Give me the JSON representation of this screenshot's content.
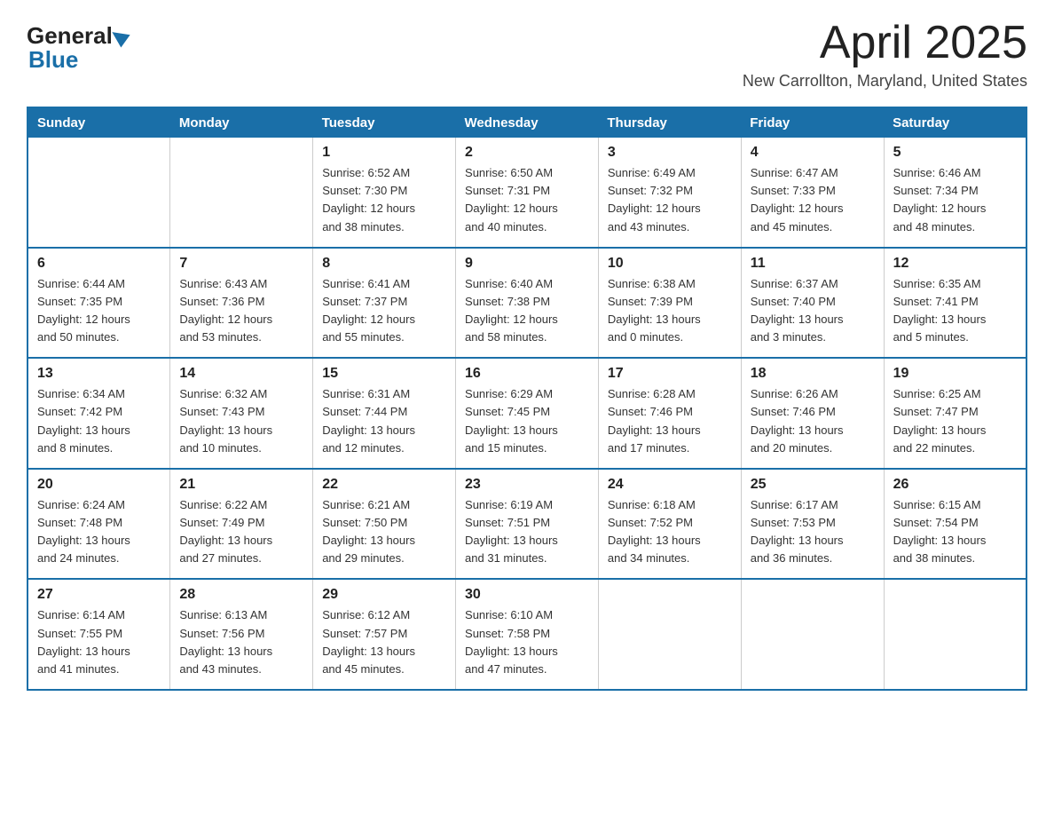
{
  "logo": {
    "general": "General",
    "blue": "Blue"
  },
  "title": "April 2025",
  "location": "New Carrollton, Maryland, United States",
  "weekdays": [
    "Sunday",
    "Monday",
    "Tuesday",
    "Wednesday",
    "Thursday",
    "Friday",
    "Saturday"
  ],
  "weeks": [
    [
      {
        "day": "",
        "info": ""
      },
      {
        "day": "",
        "info": ""
      },
      {
        "day": "1",
        "info": "Sunrise: 6:52 AM\nSunset: 7:30 PM\nDaylight: 12 hours\nand 38 minutes."
      },
      {
        "day": "2",
        "info": "Sunrise: 6:50 AM\nSunset: 7:31 PM\nDaylight: 12 hours\nand 40 minutes."
      },
      {
        "day": "3",
        "info": "Sunrise: 6:49 AM\nSunset: 7:32 PM\nDaylight: 12 hours\nand 43 minutes."
      },
      {
        "day": "4",
        "info": "Sunrise: 6:47 AM\nSunset: 7:33 PM\nDaylight: 12 hours\nand 45 minutes."
      },
      {
        "day": "5",
        "info": "Sunrise: 6:46 AM\nSunset: 7:34 PM\nDaylight: 12 hours\nand 48 minutes."
      }
    ],
    [
      {
        "day": "6",
        "info": "Sunrise: 6:44 AM\nSunset: 7:35 PM\nDaylight: 12 hours\nand 50 minutes."
      },
      {
        "day": "7",
        "info": "Sunrise: 6:43 AM\nSunset: 7:36 PM\nDaylight: 12 hours\nand 53 minutes."
      },
      {
        "day": "8",
        "info": "Sunrise: 6:41 AM\nSunset: 7:37 PM\nDaylight: 12 hours\nand 55 minutes."
      },
      {
        "day": "9",
        "info": "Sunrise: 6:40 AM\nSunset: 7:38 PM\nDaylight: 12 hours\nand 58 minutes."
      },
      {
        "day": "10",
        "info": "Sunrise: 6:38 AM\nSunset: 7:39 PM\nDaylight: 13 hours\nand 0 minutes."
      },
      {
        "day": "11",
        "info": "Sunrise: 6:37 AM\nSunset: 7:40 PM\nDaylight: 13 hours\nand 3 minutes."
      },
      {
        "day": "12",
        "info": "Sunrise: 6:35 AM\nSunset: 7:41 PM\nDaylight: 13 hours\nand 5 minutes."
      }
    ],
    [
      {
        "day": "13",
        "info": "Sunrise: 6:34 AM\nSunset: 7:42 PM\nDaylight: 13 hours\nand 8 minutes."
      },
      {
        "day": "14",
        "info": "Sunrise: 6:32 AM\nSunset: 7:43 PM\nDaylight: 13 hours\nand 10 minutes."
      },
      {
        "day": "15",
        "info": "Sunrise: 6:31 AM\nSunset: 7:44 PM\nDaylight: 13 hours\nand 12 minutes."
      },
      {
        "day": "16",
        "info": "Sunrise: 6:29 AM\nSunset: 7:45 PM\nDaylight: 13 hours\nand 15 minutes."
      },
      {
        "day": "17",
        "info": "Sunrise: 6:28 AM\nSunset: 7:46 PM\nDaylight: 13 hours\nand 17 minutes."
      },
      {
        "day": "18",
        "info": "Sunrise: 6:26 AM\nSunset: 7:46 PM\nDaylight: 13 hours\nand 20 minutes."
      },
      {
        "day": "19",
        "info": "Sunrise: 6:25 AM\nSunset: 7:47 PM\nDaylight: 13 hours\nand 22 minutes."
      }
    ],
    [
      {
        "day": "20",
        "info": "Sunrise: 6:24 AM\nSunset: 7:48 PM\nDaylight: 13 hours\nand 24 minutes."
      },
      {
        "day": "21",
        "info": "Sunrise: 6:22 AM\nSunset: 7:49 PM\nDaylight: 13 hours\nand 27 minutes."
      },
      {
        "day": "22",
        "info": "Sunrise: 6:21 AM\nSunset: 7:50 PM\nDaylight: 13 hours\nand 29 minutes."
      },
      {
        "day": "23",
        "info": "Sunrise: 6:19 AM\nSunset: 7:51 PM\nDaylight: 13 hours\nand 31 minutes."
      },
      {
        "day": "24",
        "info": "Sunrise: 6:18 AM\nSunset: 7:52 PM\nDaylight: 13 hours\nand 34 minutes."
      },
      {
        "day": "25",
        "info": "Sunrise: 6:17 AM\nSunset: 7:53 PM\nDaylight: 13 hours\nand 36 minutes."
      },
      {
        "day": "26",
        "info": "Sunrise: 6:15 AM\nSunset: 7:54 PM\nDaylight: 13 hours\nand 38 minutes."
      }
    ],
    [
      {
        "day": "27",
        "info": "Sunrise: 6:14 AM\nSunset: 7:55 PM\nDaylight: 13 hours\nand 41 minutes."
      },
      {
        "day": "28",
        "info": "Sunrise: 6:13 AM\nSunset: 7:56 PM\nDaylight: 13 hours\nand 43 minutes."
      },
      {
        "day": "29",
        "info": "Sunrise: 6:12 AM\nSunset: 7:57 PM\nDaylight: 13 hours\nand 45 minutes."
      },
      {
        "day": "30",
        "info": "Sunrise: 6:10 AM\nSunset: 7:58 PM\nDaylight: 13 hours\nand 47 minutes."
      },
      {
        "day": "",
        "info": ""
      },
      {
        "day": "",
        "info": ""
      },
      {
        "day": "",
        "info": ""
      }
    ]
  ]
}
